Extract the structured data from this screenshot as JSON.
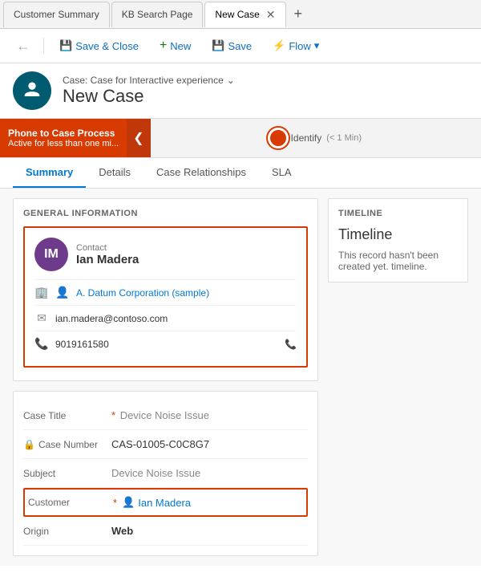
{
  "browser": {
    "tabs": [
      {
        "id": "customer-summary",
        "label": "Customer Summary",
        "active": false
      },
      {
        "id": "kb-search-page",
        "label": "KB Search Page",
        "active": false
      },
      {
        "id": "new-case",
        "label": "New Case",
        "active": true
      }
    ],
    "add_tab_label": "+"
  },
  "toolbar": {
    "back_icon": "←",
    "save_close_icon": "💾",
    "save_close_label": "Save & Close",
    "new_icon": "+",
    "new_label": "New",
    "save_icon": "💾",
    "save_label": "Save",
    "flow_icon": "⚡",
    "flow_label": "Flow",
    "flow_chevron": "▾"
  },
  "record": {
    "avatar_initials": "🔊",
    "entity_label": "Case: Case for Interactive experience",
    "chevron": "⌄",
    "title": "New Case"
  },
  "bpf": {
    "process_name": "Phone to Case Process",
    "process_status": "Active for less than one mi...",
    "collapse_icon": "❮",
    "stage_label": "Identify",
    "stage_time": "(< 1 Min)"
  },
  "tabs": [
    {
      "id": "summary",
      "label": "Summary",
      "active": true
    },
    {
      "id": "details",
      "label": "Details",
      "active": false
    },
    {
      "id": "case-relationships",
      "label": "Case Relationships",
      "active": false
    },
    {
      "id": "sla",
      "label": "SLA",
      "active": false
    }
  ],
  "general_info": {
    "section_title": "GENERAL INFORMATION",
    "contact": {
      "avatar_initials": "IM",
      "label": "Contact",
      "name": "Ian Madera",
      "company_icon": "🏢",
      "company_name": "A. Datum Corporation (sample)",
      "email_icon": "✉",
      "email": "ian.madera@contoso.com",
      "phone_icon": "📞",
      "phone": "9019161580",
      "phone_end_icon": "📞"
    }
  },
  "case_form": {
    "case_title_label": "Case Title",
    "case_title_value": "Device Noise Issue",
    "case_number_label": "Case Number",
    "case_number_icon": "🔒",
    "case_number_value": "CAS-01005-C0C8G7",
    "subject_label": "Subject",
    "subject_value": "Device Noise Issue",
    "customer_label": "Customer",
    "customer_icon": "👤",
    "customer_value": "Ian Madera",
    "origin_label": "Origin",
    "origin_value": "Web"
  },
  "timeline": {
    "section_title": "TIMELINE",
    "title": "Timeline",
    "empty_message": "This record hasn't been created yet. timeline."
  }
}
